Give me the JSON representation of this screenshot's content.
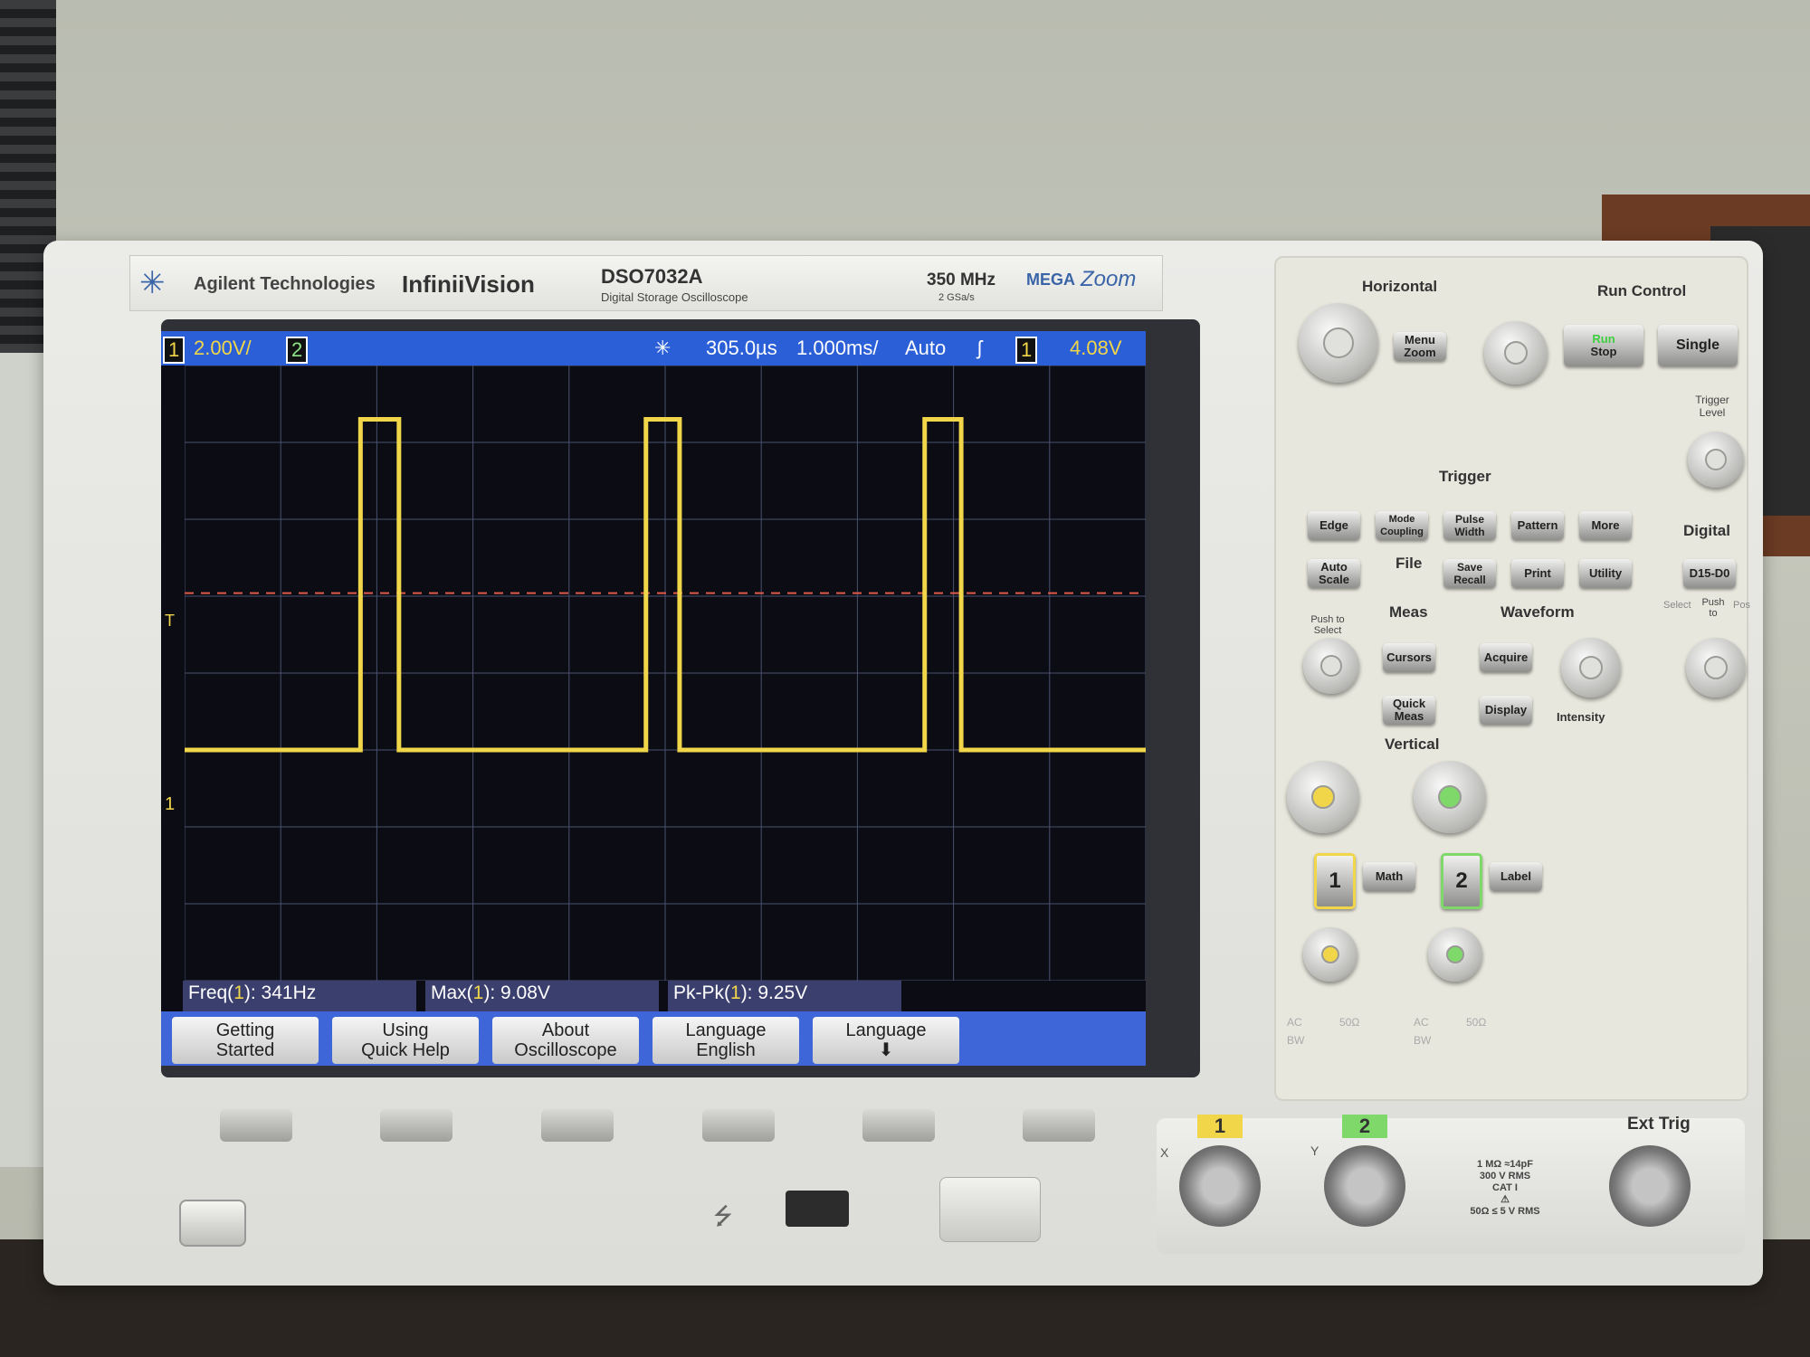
{
  "brand": {
    "logo_icon": "agilent-spark-icon",
    "company": "Agilent Technologies",
    "series": "InfiniiVision",
    "model": "DSO7032A",
    "model_desc": "Digital Storage Oscilloscope",
    "bandwidth": "350 MHz",
    "sample_rate": "2 GSa/s",
    "mega": "MEGA",
    "zoom": "Zoom"
  },
  "status": {
    "ch1_num": "1",
    "ch1_scale": "2.00V/",
    "ch2_num": "2",
    "time_delay": "305.0µs",
    "time_scale": "1.000ms/",
    "trigger_mode": "Auto",
    "trigger_slope": "ʃ",
    "trigger_source": "1",
    "trigger_level": "4.08V"
  },
  "screen": {
    "trigger_marker": "T",
    "ch1_ground_marker": "1"
  },
  "waveform": {
    "low_level_v": 0.0,
    "high_level_v": 8.6,
    "trigger_level_v": 4.08,
    "color": "#f2d64a"
  },
  "measurements": [
    {
      "prefix": "Freq(",
      "ch": "1",
      "suffix": "): 341Hz"
    },
    {
      "prefix": "Max(",
      "ch": "1",
      "suffix": "): 9.08V"
    },
    {
      "prefix": "Pk-Pk(",
      "ch": "1",
      "suffix": "): 9.25V"
    }
  ],
  "softkeys": [
    {
      "line1": "Getting",
      "line2": "Started"
    },
    {
      "line1": "Using",
      "line2": "Quick Help"
    },
    {
      "line1": "About",
      "line2": "Oscilloscope"
    },
    {
      "line1": "Language",
      "line2": "English"
    },
    {
      "line1": "Language",
      "line2": "⬇"
    }
  ],
  "panel": {
    "horizontal": "Horizontal",
    "run_control": "Run Control",
    "menu_zoom": "Menu Zoom",
    "run_stop_run": "Run",
    "run_stop_stop": "Stop",
    "single": "Single",
    "trigger_level": "Trigger Level",
    "trigger": "Trigger",
    "edge": "Edge",
    "mode_coupling": "Mode Coupling",
    "pulse_width": "Pulse Width",
    "pattern": "Pattern",
    "more": "More",
    "digital": "Digital",
    "auto_scale": "Auto Scale",
    "file": "File",
    "save_recall": "Save Recall",
    "print": "Print",
    "utility": "Utility",
    "d15_d0": "D15-D0",
    "push_to_select": "Push to Select",
    "meas": "Meas",
    "waveform": "Waveform",
    "select": "Select",
    "push_to": "Push to",
    "pos": "Pos",
    "cursors": "Cursors",
    "acquire": "Acquire",
    "quick_meas": "Quick Meas",
    "display": "Display",
    "intensity": "Intensity",
    "vertical": "Vertical",
    "ch1": "1",
    "math": "Math",
    "ch2": "2",
    "label": "Label",
    "ac": "AC",
    "fifty_ohm": "50Ω",
    "bw": "BW"
  },
  "io": {
    "x": "X",
    "y": "Y",
    "ch1": "1",
    "ch2": "2",
    "ext_trig": "Ext Trig",
    "spec1": "1 MΩ ≈14pF",
    "spec2": "300 V RMS",
    "spec3": "CAT I",
    "spec4": "50Ω ≤ 5 V RMS"
  },
  "colors": {
    "ch1": "#f2d64a",
    "ch2": "#7fd96a",
    "status_bar": "#2b5fd8",
    "softkey_bar": "#3f66d9",
    "trigger_line": "#e05a4a",
    "grid": "#4a5170"
  }
}
